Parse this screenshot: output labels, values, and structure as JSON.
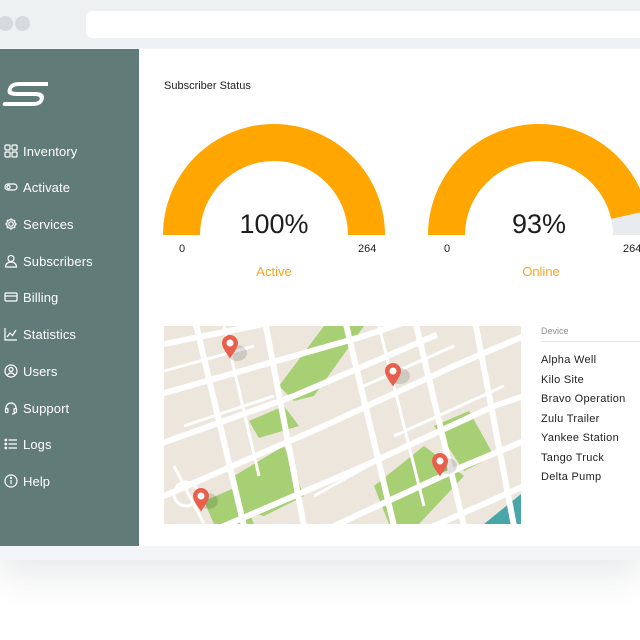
{
  "sidebar": {
    "items": [
      {
        "label": "Inventory",
        "icon": "grid-icon"
      },
      {
        "label": "Activate",
        "icon": "toggle-icon"
      },
      {
        "label": "Services",
        "icon": "gear-icon"
      },
      {
        "label": "Subscribers",
        "icon": "user-icon"
      },
      {
        "label": "Billing",
        "icon": "credit-card-icon"
      },
      {
        "label": "Statistics",
        "icon": "chart-icon"
      },
      {
        "label": "Users",
        "icon": "user-circle-icon"
      },
      {
        "label": "Support",
        "icon": "headset-icon"
      },
      {
        "label": "Logs",
        "icon": "list-icon"
      },
      {
        "label": "Help",
        "icon": "info-icon"
      }
    ]
  },
  "main": {
    "section_title": "Subscriber Status",
    "gauges": [
      {
        "value_text": "100%",
        "fraction": 1.0,
        "min": "0",
        "max": "264",
        "label": "Active"
      },
      {
        "value_text": "93%",
        "fraction": 0.93,
        "min": "0",
        "max": "264",
        "label": "Online"
      }
    ],
    "device_header": "Device",
    "devices": [
      "Alpha Well",
      "Kilo Site",
      "Bravo Operation",
      "Zulu Trailer",
      "Yankee Station",
      "Tango Truck",
      "Delta Pump"
    ]
  },
  "colors": {
    "sidebar_bg": "#617b79",
    "gauge_fill": "#ffa700",
    "gauge_track": "#e8ecee",
    "label_accent": "#f5a623",
    "map_pin": "#e8604c",
    "map_park": "#a7cf74",
    "map_block": "#ece6dc",
    "map_water": "#4aa7a9"
  }
}
